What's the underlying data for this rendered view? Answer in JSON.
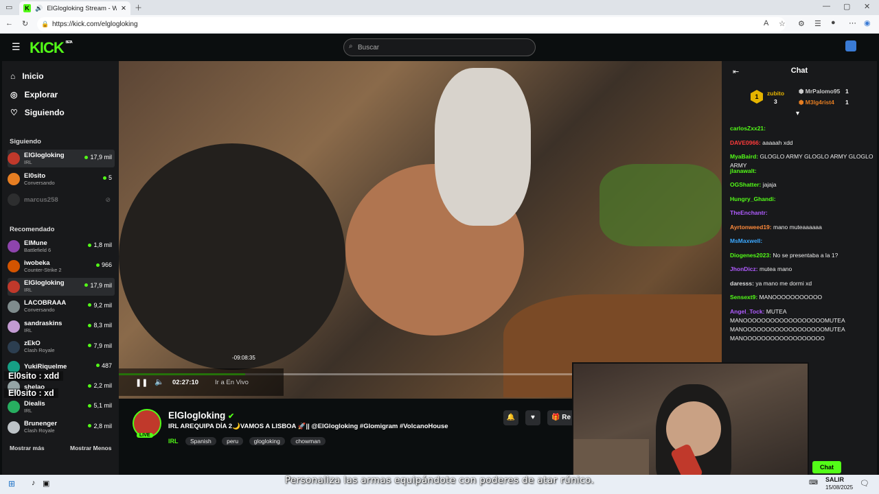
{
  "browser": {
    "tab_title": "ElGlogloking Stream - Watch",
    "url": "https://kick.com/elglogloking"
  },
  "kick": {
    "logo": "KICK",
    "beta": "BETA",
    "search_placeholder": "Buscar",
    "nav": [
      {
        "label": "Inicio",
        "icon": "home-icon"
      },
      {
        "label": "Explorar",
        "icon": "compass-icon"
      },
      {
        "label": "Siguiendo",
        "icon": "heart-icon"
      }
    ],
    "following_title": "Siguiendo",
    "following": [
      {
        "name": "ElGlogloking",
        "category": "IRL",
        "viewers": "17,9 mil",
        "color": "#c0392b"
      },
      {
        "name": "El0sito",
        "category": "Conversando",
        "viewers": "5",
        "color": "#e67e22"
      },
      {
        "name": "marcus258",
        "category": "",
        "viewers": "",
        "color": "#555555"
      }
    ],
    "recommended_title": "Recomendado",
    "recommended": [
      {
        "name": "ElMune",
        "category": "Battlefield 6",
        "viewers": "1,8 mil",
        "color": "#8e44ad"
      },
      {
        "name": "iwobeka",
        "category": "Counter-Strike 2",
        "viewers": "966",
        "color": "#d35400"
      },
      {
        "name": "ElGlogloking",
        "category": "IRL",
        "viewers": "17,9 mil",
        "color": "#c0392b"
      },
      {
        "name": "LACOBRAAA",
        "category": "Conversando",
        "viewers": "9,2 mil",
        "color": "#7f8c8d"
      },
      {
        "name": "sandraskins",
        "category": "IRL",
        "viewers": "8,3 mil",
        "color": "#c39bd3"
      },
      {
        "name": "zEkO",
        "category": "Clash Royale",
        "viewers": "7,9 mil",
        "color": "#2c3e50"
      },
      {
        "name": "YukiRiquelme",
        "category": "",
        "viewers": "487",
        "color": "#16a085"
      },
      {
        "name": "shelao",
        "category": "",
        "viewers": "2,2 mil",
        "color": "#95a5a6"
      },
      {
        "name": "Diealis",
        "category": "IRL",
        "viewers": "5,1 mil",
        "color": "#27ae60"
      },
      {
        "name": "Brunenger",
        "category": "Clash Royale",
        "viewers": "2,8 mil",
        "color": "#bdc3c7"
      }
    ],
    "show_more": "Mostrar más",
    "show_less": "Mostrar Menos"
  },
  "player": {
    "hover_time": "-09:08:35",
    "elapsed": "02:27:10",
    "go_live": "Ir a En Vivo",
    "progress_fraction": 0.21
  },
  "stream": {
    "streamer": "ElGlogloking",
    "live_badge": "LIVE",
    "title": "IRL AREQUIPA DÍA 2🌙VAMOS A LISBOA 🚀|| @ElGlogloking #Glomigram #VolcanoHouse",
    "category": "IRL",
    "tags": [
      "Spanish",
      "peru",
      "glogloking",
      "chowman"
    ],
    "sub_label": "Re"
  },
  "chat": {
    "title": "Chat",
    "leaders": [
      {
        "name": "zubito",
        "count": "3"
      },
      {
        "name": "MrPalomo95",
        "count": "1"
      },
      {
        "name": "M3lg4rist4",
        "count": "1"
      }
    ],
    "messages": [
      {
        "user": "carlosZxx21:",
        "text": "",
        "color": "#53fc18"
      },
      {
        "user": "DAVE0966:",
        "text": "aaaaah xdd",
        "color": "#ff3b3b"
      },
      {
        "user": "MyaBaird:",
        "text": "GLOGLO ARMY  GLOGLO ARMY  GLOGLO ARMY",
        "color": "#53fc18"
      },
      {
        "user": "jlanawalt:",
        "text": "",
        "color": "#53fc18"
      },
      {
        "user": "OGShatter:",
        "text": "jajaja",
        "color": "#53fc18"
      },
      {
        "user": "Hungry_Ghandi:",
        "text": "",
        "color": "#53fc18"
      },
      {
        "user": "TheEnchantr:",
        "text": "",
        "color": "#b05cff"
      },
      {
        "user": "Ayrtonweed19:",
        "text": "mano muteaaaaaa",
        "color": "#ff8a3b"
      },
      {
        "user": "MsMaxwell:",
        "text": "",
        "color": "#3ba8ff"
      },
      {
        "user": "Diogenes2023:",
        "text": "No se presentaba a la 1?",
        "color": "#53fc18"
      },
      {
        "user": "JhonDicz:",
        "text": "mutea mano",
        "color": "#b05cff"
      },
      {
        "user": "daresss:",
        "text": "ya mano me dormi xd",
        "color": "#dddddd"
      },
      {
        "user": "Sensext9:",
        "text": "MANOOOOOOOOOOO",
        "color": "#53fc18"
      },
      {
        "user": "Angel_Tock:",
        "text": "MUTEA MANOOOOOOOOOOOOOOOOOOMUTEA MANOOOOOOOOOOOOOOOOOOMUTEA MANOOOOOOOOOOOOOOOOOO",
        "color": "#b05cff"
      }
    ],
    "send_label": "Chat"
  },
  "overlay": {
    "line1": "El0sito : xdd",
    "line2": "El0sito : xd",
    "subtitle": "Personaliza las armas equipándote con poderes de atar rúnico."
  },
  "taskbar": {
    "time": "SALIR",
    "date": "15/08/2025"
  }
}
